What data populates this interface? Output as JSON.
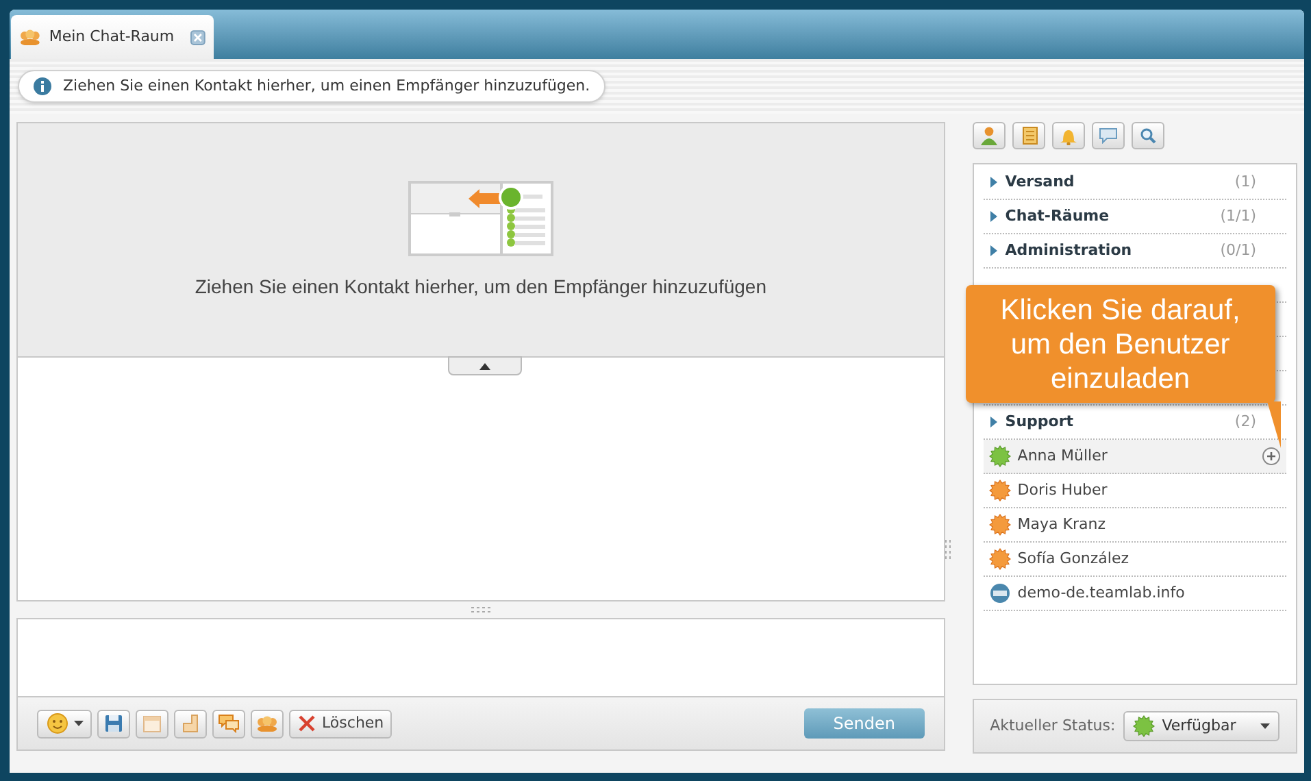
{
  "tab": {
    "label": "Mein Chat-Raum",
    "selected": true
  },
  "info_bar": {
    "text": "Ziehen Sie einen Kontakt hierher, um einen Empfänger hinzuzufügen."
  },
  "drop_zone": {
    "text": "Ziehen Sie einen Kontakt hierher, um den Empfänger hinzuzufügen"
  },
  "groups": [
    {
      "label": "Versand",
      "count": "(1)"
    },
    {
      "label": "Chat-Räume",
      "count": "(1/1)"
    },
    {
      "label": "Administration",
      "count": "(0/1)"
    },
    {
      "label": "Support",
      "count": "(2)"
    }
  ],
  "contacts": [
    {
      "name": "Anna Müller",
      "kind": "online",
      "hovered": true
    },
    {
      "name": "Doris Huber",
      "kind": "away",
      "hovered": false
    },
    {
      "name": "Maya Kranz",
      "kind": "away",
      "hovered": false
    },
    {
      "name": "Sofía González",
      "kind": "away",
      "hovered": false
    },
    {
      "name": "demo-de.teamlab.info",
      "kind": "portal",
      "hovered": false
    }
  ],
  "callout": {
    "text": "Klicken Sie darauf, um den Benutzer einzuladen"
  },
  "toolbar": [
    {
      "kind": "emoji"
    },
    {
      "kind": "save"
    },
    {
      "kind": "calendar"
    },
    {
      "kind": "file"
    },
    {
      "kind": "chat"
    },
    {
      "kind": "group"
    },
    {
      "kind": "delete",
      "label": "Löschen"
    }
  ],
  "send_button": {
    "label": "Senden"
  },
  "status": {
    "label": "Aktueller Status:",
    "value": "Verfügbar",
    "kind": "online"
  }
}
